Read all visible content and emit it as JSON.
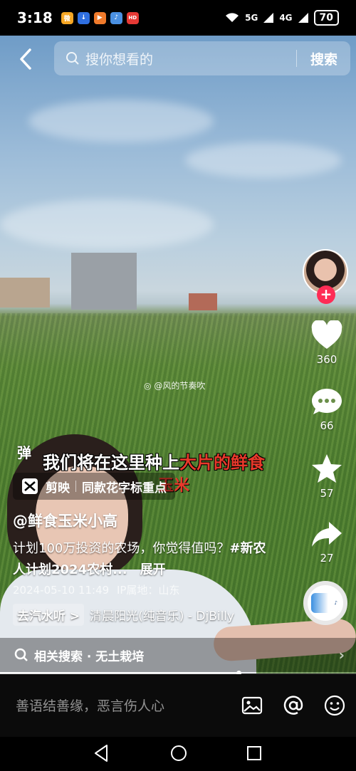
{
  "status_bar": {
    "time": "3:18",
    "apps": [
      {
        "icon": "weibo-icon",
        "color": "#f5a623",
        "glyph": "微"
      },
      {
        "icon": "download-icon",
        "color": "#2f6fe0",
        "glyph": "↓"
      },
      {
        "icon": "video-icon",
        "color": "#f07a2b",
        "glyph": "▶"
      },
      {
        "icon": "music-icon",
        "color": "#4a90e2",
        "glyph": "♪"
      },
      {
        "icon": "news-icon",
        "color": "#e53935",
        "glyph": "HD"
      }
    ],
    "net1": "5G",
    "net2": "4G",
    "battery": "70"
  },
  "search": {
    "placeholder": "搜你想看的",
    "button": "搜索"
  },
  "actions": {
    "likes": "360",
    "comments": "66",
    "favorites": "57",
    "shares": "27"
  },
  "overlay": {
    "watermark": "@风的节奏吹",
    "danmaku": "弹",
    "caption_main": "我们将在这里种上",
    "caption_highlight": "大片的鲜食",
    "caption_sub": "玉米"
  },
  "capcut": {
    "app": "剪映",
    "template": "同款花字标重点"
  },
  "post": {
    "author": "@鲜食玉米小高",
    "desc_text": "计划100万投资的农场，你觉得值吗？",
    "desc_tag": "#新农人计划2024农村...",
    "expand": "展开",
    "date": "2024-05-10 11:49",
    "location": "IP属地：山东"
  },
  "music": {
    "chip": "去汽水听 >",
    "title": "清晨阳光(纯音乐) - DjBilly"
  },
  "related": {
    "text": "相关搜索 · 无土栽培"
  },
  "progress": {
    "fraction": 0.67
  },
  "comment_bar": {
    "placeholder": "善语结善缘，恶言伤人心"
  },
  "colors": {
    "follow": "#fe2c55",
    "caption_highlight": "#e8392b"
  }
}
